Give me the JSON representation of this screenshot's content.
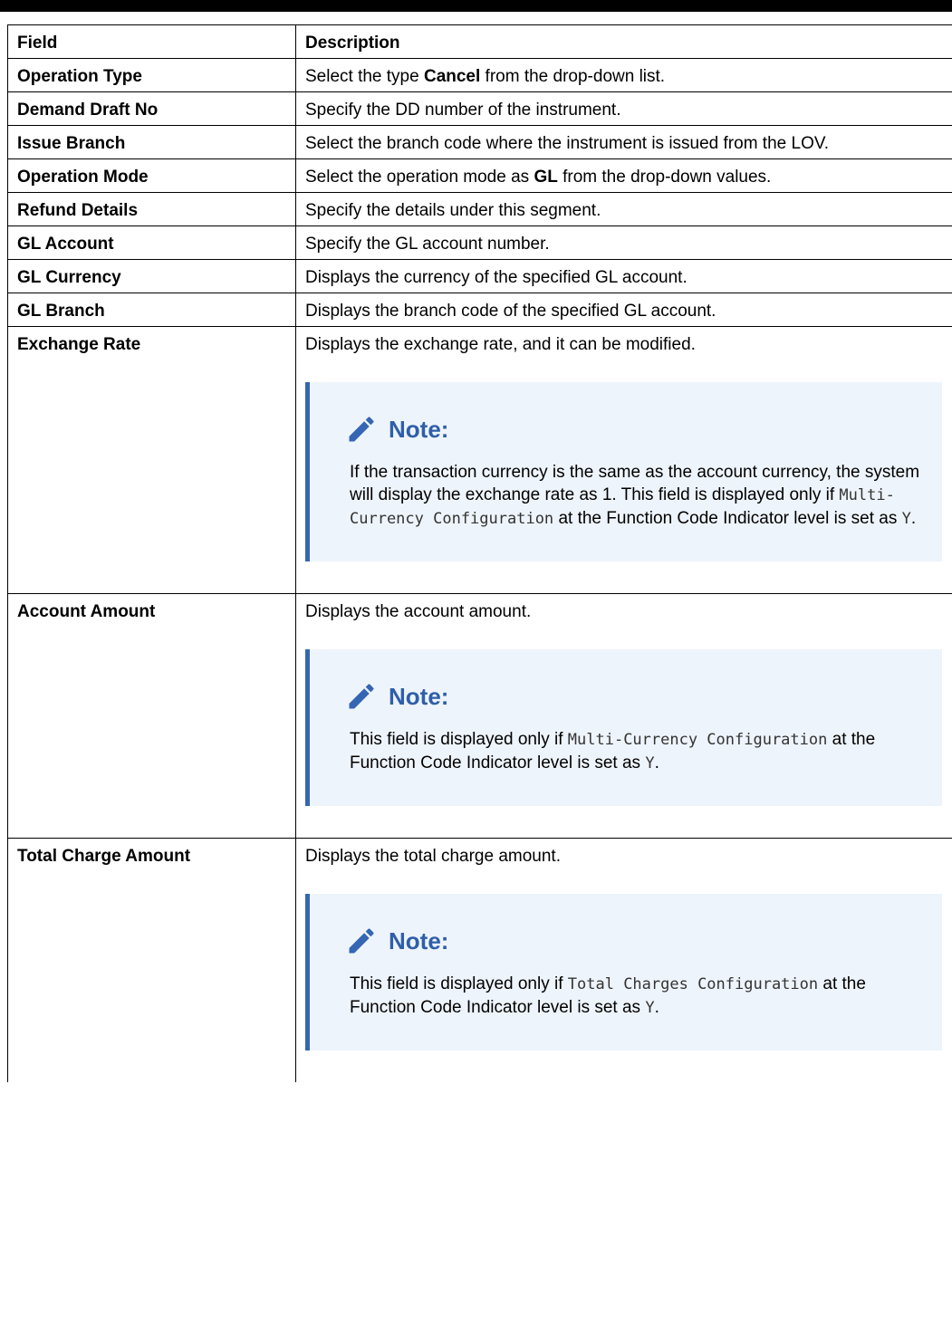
{
  "header": {
    "field": "Field",
    "description": "Description"
  },
  "rows": [
    {
      "field": "Operation Type",
      "desc_pre": "Select the type ",
      "desc_bold": "Cancel",
      "desc_post": " from the drop-down list."
    },
    {
      "field": "Demand Draft No",
      "desc": "Specify the DD number of the instrument."
    },
    {
      "field": "Issue Branch",
      "desc": "Select the branch code where the instrument is issued from the LOV."
    },
    {
      "field": "Operation Mode",
      "desc_pre": "Select the operation mode as ",
      "desc_bold": "GL",
      "desc_post": " from the drop-down values."
    },
    {
      "field": "Refund Details",
      "desc": "Specify the details under this segment."
    },
    {
      "field": "GL Account",
      "desc": "Specify the GL account number."
    },
    {
      "field": "GL Currency",
      "desc": "Displays the currency of the specified GL account."
    },
    {
      "field": "GL Branch",
      "desc": "Displays the branch code of the specified GL account."
    },
    {
      "field": "Exchange Rate",
      "desc": "Displays the exchange rate, and it can be modified.",
      "note": {
        "title": "Note:",
        "text1": "If the transaction currency is the same as the account currency, the system will display the exchange rate as 1. This field is displayed only if ",
        "code1": "Multi-Currency Configuration",
        "text2": " at the Function Code Indicator level is set as ",
        "code2": "Y",
        "text3": "."
      }
    },
    {
      "field": "Account Amount",
      "desc": "Displays the account amount.",
      "note": {
        "title": "Note:",
        "text1": "This field is displayed only if ",
        "code1": "Multi-Currency Configuration",
        "text2": " at the Function Code Indicator level is set as ",
        "code2": "Y",
        "text3": "."
      }
    },
    {
      "field": "Total Charge Amount",
      "desc": "Displays the total charge amount.",
      "note": {
        "title": "Note:",
        "text1": "This field is displayed only if ",
        "code1": "Total Charges Configuration",
        "text2": " at the Function Code Indicator level is set as ",
        "code2": "Y",
        "text3": "."
      }
    }
  ],
  "colors": {
    "note_accent": "#3466b3",
    "note_background": "#eef4fb",
    "note_title": "#2f5fa8"
  },
  "icons": {
    "note": "pencil-icon"
  }
}
